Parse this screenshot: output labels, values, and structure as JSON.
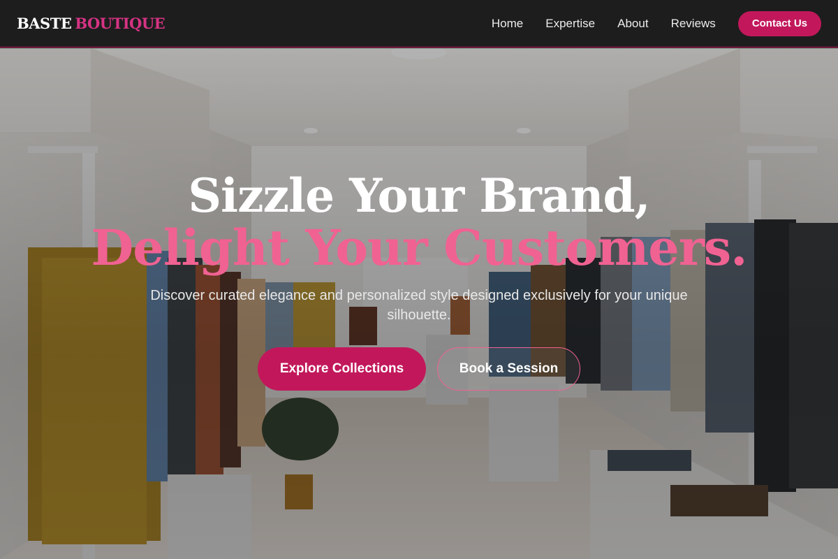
{
  "brand": {
    "part1": "BASTE",
    "part2": "BOUTIQUE",
    "accent_color": "#d63384"
  },
  "nav": {
    "items": [
      {
        "label": "Home"
      },
      {
        "label": "Expertise"
      },
      {
        "label": "About"
      },
      {
        "label": "Reviews"
      }
    ],
    "cta_label": "Contact Us"
  },
  "hero": {
    "title_line1": "Sizzle Your Brand,",
    "title_line2": "Delight Your Customers.",
    "subtitle": "Discover curated elegance and personalized style designed exclusively for your unique silhouette.",
    "primary_button": "Explore Collections",
    "secondary_button": "Book a Session"
  },
  "colors": {
    "primary": "#c2185b",
    "accent_pink": "#f06292",
    "nav_background": "#1d1d1d"
  }
}
